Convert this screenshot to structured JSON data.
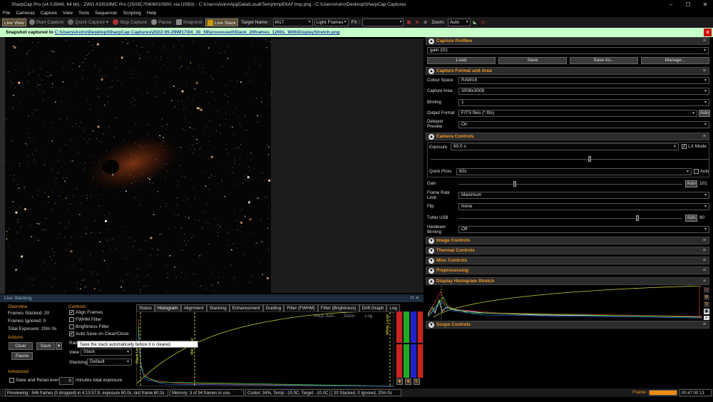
{
  "window": {
    "title": "SharpCap Pro (v4.0.8949, 64 bit) - ZWO ASI533MC Pro (2503C70406010900, via USB3) - C:\\Users\\Astro\\AppData\\Local\\Temp\\tmpE6AF.tmp.png - C:\\Users\\Astro\\Desktop\\SharpCap Captures",
    "minimize": "–",
    "maximize": "☐",
    "close": "✕"
  },
  "menu": [
    "File",
    "Cameras",
    "Capture",
    "View",
    "Tools",
    "Sequencer",
    "Scripting",
    "Help"
  ],
  "toolbar": {
    "live_view": "Live View",
    "start_capture": "Start Capture",
    "quick_capture": "Quick Capture",
    "stop_capture": "Stop Capture",
    "pause": "Pause",
    "snapshot": "Snapshot",
    "live_stack": "Live Stack",
    "target_label": "Target Name :",
    "target_value": "M17",
    "frame_type": "Light Frames",
    "fx_label": "FX :",
    "zoom_label": "Zoom:",
    "zoom_value": "Auto"
  },
  "snapshot_bar": {
    "prefix": "Snapshot captured to ",
    "path": "C:\\Users\\Astro\\Desktop\\SharpCap Captures\\2022-05-29\\M17\\04_30_59\\processed\\Stack_20frames_1200s_WithDisplayStretch.png",
    "close": "✕"
  },
  "right_panel": {
    "capture_profiles": {
      "header": "Capture Profiles",
      "profile": "gain 101",
      "load": "Load",
      "save": "Save",
      "save_as": "Save As...",
      "manage": "Manage..."
    },
    "capture_format": {
      "header": "Capture Format and Area",
      "colour_space_label": "Colour Space",
      "colour_space": "RAW16",
      "capture_area_label": "Capture Area",
      "capture_area": "3008x3008",
      "binning_label": "Binning",
      "binning": "1",
      "output_format_label": "Output Format",
      "output_format": "FITS files (*.fits)",
      "output_auto": "Auto",
      "debayer_label": "Debayer Preview",
      "debayer": "On"
    },
    "camera_controls": {
      "header": "Camera Controls",
      "exposure_label": "Exposure",
      "exposure_value": "60.0 s",
      "lx_mode": "LX Mode",
      "quick_picks_label": "Quick Picks",
      "quick_picks_value": "60s",
      "quick_auto": "Auto",
      "gain_label": "Gain",
      "gain_auto": "Auto",
      "gain_value": "101",
      "gain_level": 0.25,
      "frame_rate_label": "Frame Rate Limit",
      "frame_rate": "Maximum",
      "flip_label": "Flip",
      "flip": "None",
      "turbo_label": "Turbo USB",
      "turbo_auto": "Auto",
      "turbo_value": "80",
      "turbo_level": 0.8,
      "hw_binning_label": "Hardware Binning",
      "hw_binning": "Off"
    },
    "collapsed": [
      "Image Controls",
      "Thermal Controls",
      "Misc Controls",
      "Preprocessing"
    ],
    "histogram_header": "Display Histogram Stretch",
    "scope_header": "Scope Controls"
  },
  "live_stacking": {
    "title": "Live Stacking",
    "overview": "Overview",
    "frames_stacked": "Frames Stacked: 20",
    "frames_ignored": "Frames Ignored: 0",
    "total_exposure": "Total Exposure:",
    "total_exposure_value": "20m 0s",
    "actions": "Actions",
    "clear": "Clear",
    "save": "Save",
    "pause": "Pause",
    "advanced": "Advanced",
    "save_reset": "Save and Reset every",
    "save_reset_value": "0",
    "save_reset_suffix": "minutes total exposure",
    "controls": "Controls",
    "align_frames": "Align Frames",
    "fwhm_filter": "FWHM Filter",
    "brightness_filter": "Brightness Filter",
    "auto_save": "Auto Save on Clear/Close",
    "raw_label": "Raw",
    "view_label": "View",
    "view_value": "Stack",
    "stacking_label": "Stacking",
    "stacking_value": "Default",
    "tooltip": "Save the stack automatically before it is cleared.",
    "tabs": [
      "Status",
      "Histogram",
      "Alignment",
      "Stacking",
      "Enhancement",
      "Guiding",
      "Filter (FWHM)",
      "Filter (Brightness)",
      "Drift Graph",
      "Log"
    ],
    "histo_controls": "Horiz. Axis:",
    "zoom": "Zoom",
    "log": "Log",
    "black_level": "Black Level",
    "mid_level": "Mid Level",
    "white_level": "White Level"
  },
  "status": {
    "previewing": "Previewing : 546 frames (0 dropped) in 4:13:57.9, exposure 60.0s, last frame 60.3s",
    "memory": "Memory: 3 of 94 frames in use.",
    "cooler": "Cooler: 34%, Temp: -10.0C, Target: -10.0C",
    "stacked": "20 Stacked, 0 Ignored, 20m 0s",
    "frame_label": "Frame :",
    "time": "00:47:00:13"
  }
}
